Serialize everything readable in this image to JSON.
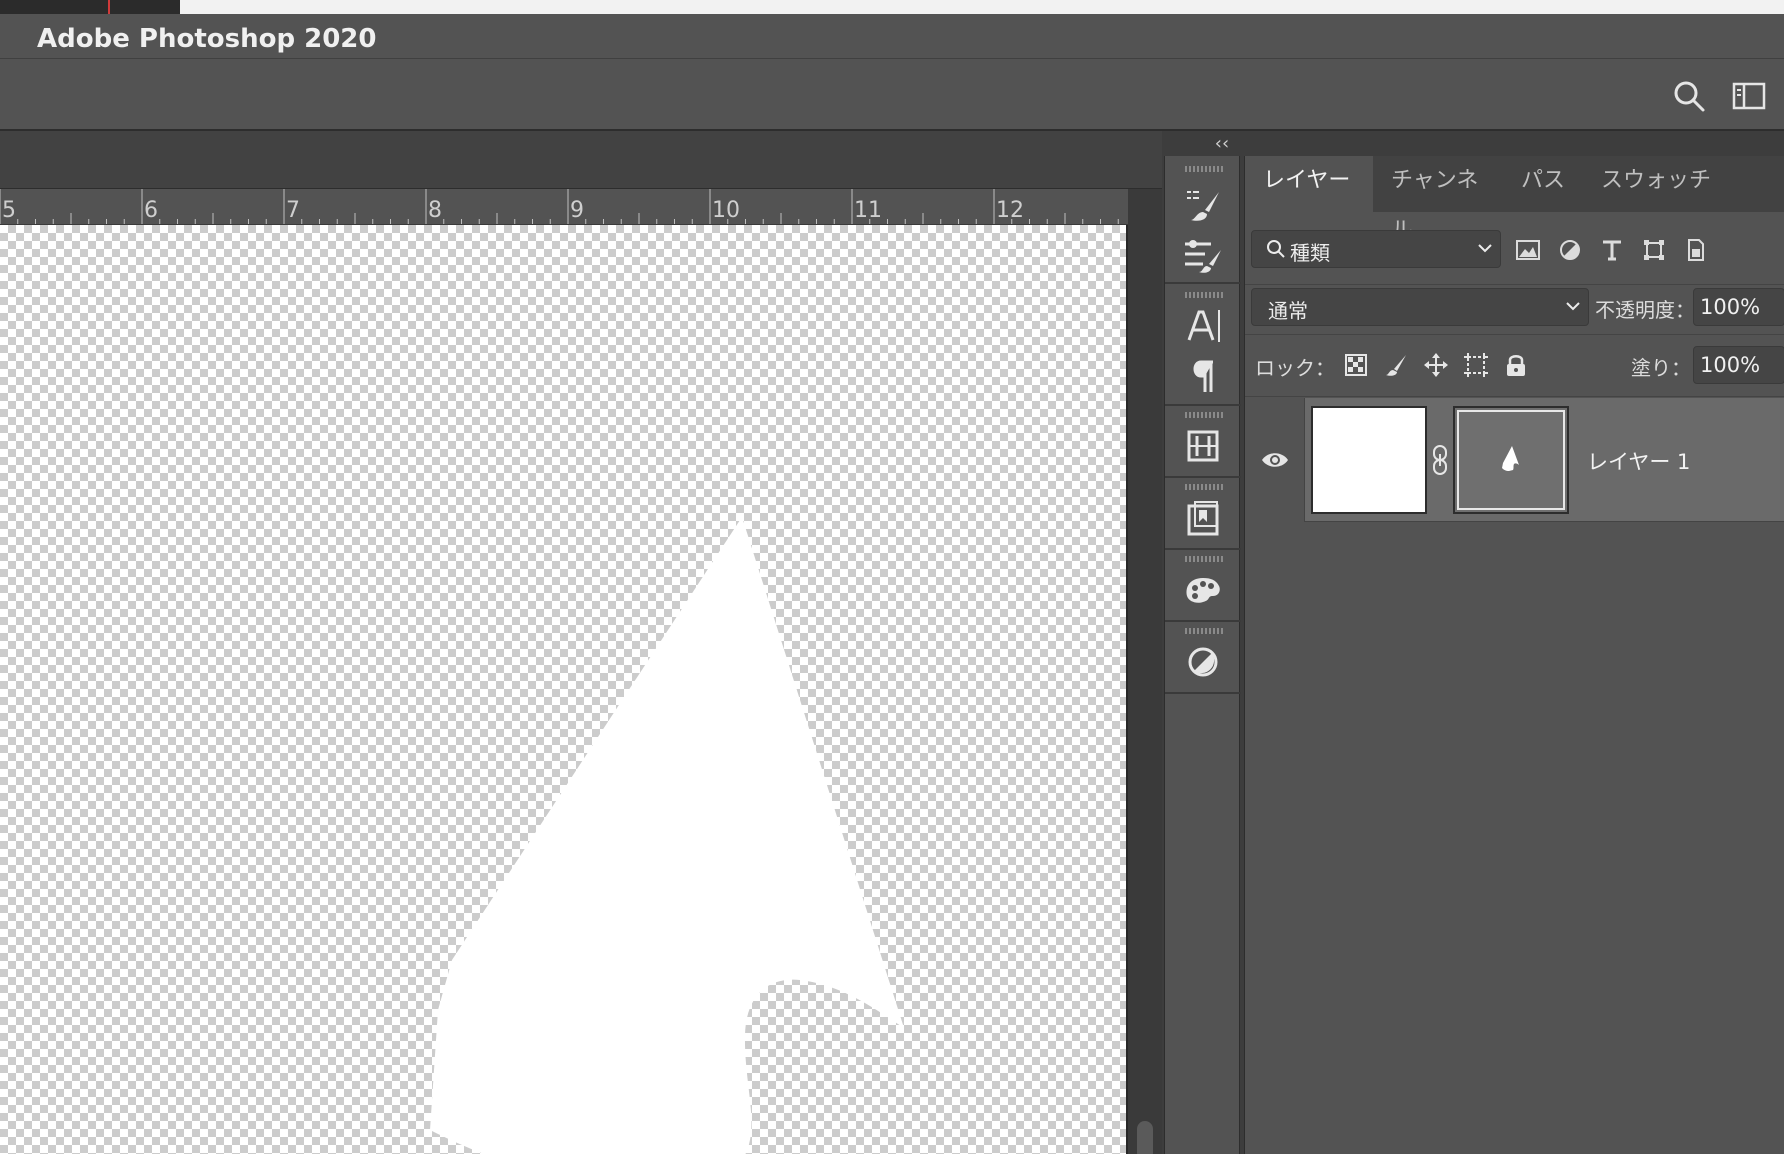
{
  "app": {
    "title": "Adobe Photoshop 2020"
  },
  "toolbar": {
    "search_icon": "search-icon",
    "workspace_icon": "workspace-icon"
  },
  "ruler": {
    "labels": [
      "5",
      "6",
      "7",
      "8",
      "9",
      "10",
      "11",
      "12"
    ]
  },
  "dock": {
    "collapse_label": "‹‹"
  },
  "panel": {
    "tabs": [
      {
        "label": "レイヤー",
        "active": true
      },
      {
        "label": "チャンネル",
        "active": false
      },
      {
        "label": "パス",
        "active": false
      },
      {
        "label": "スウォッチ",
        "active": false
      }
    ],
    "filter": {
      "label": "種類"
    },
    "blend_mode": "通常",
    "opacity": {
      "label": "不透明度：",
      "value": "100%"
    },
    "lock": {
      "label": "ロック："
    },
    "fill": {
      "label": "塗り：",
      "value": "100%"
    },
    "layers": [
      {
        "name": "レイヤー 1",
        "visible": true
      }
    ]
  },
  "colors": {
    "panel_bg": "#535353",
    "dark_bg": "#323232",
    "text": "#e6e6e6",
    "selected_row": "#6a6a6a"
  }
}
